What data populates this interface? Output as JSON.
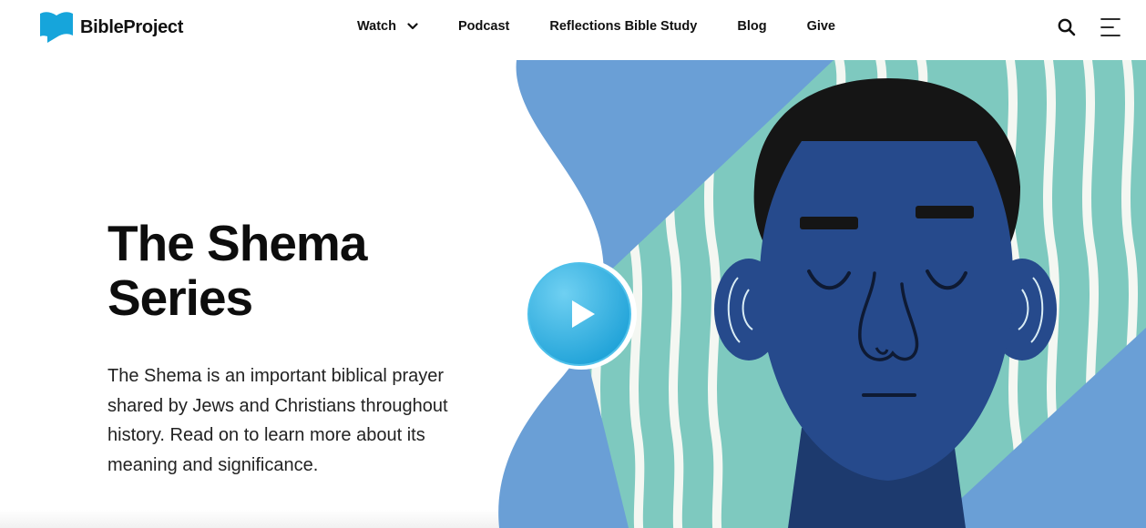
{
  "header": {
    "logo_text": "BibleProject",
    "nav": [
      {
        "label": "Watch",
        "has_dropdown": true
      },
      {
        "label": "Podcast"
      },
      {
        "label": "Reflections Bible Study"
      },
      {
        "label": "Blog"
      },
      {
        "label": "Give"
      }
    ],
    "icons": {
      "search": "search-icon",
      "menu": "hamburger-menu-icon",
      "dropdown": "chevron-down-icon"
    }
  },
  "hero": {
    "title": "The Shema Series",
    "description": "The Shema is an important biblical prayer shared by Jews and Christians throughout history. Read on to learn more about its meaning and significance.",
    "play_icon": "play-icon"
  },
  "colors": {
    "brand_blue": "#16a5db",
    "art_light_blue": "#6a9fd6",
    "art_teal": "#7ec9bf",
    "face_navy": "#264a8c",
    "hair_black": "#151515",
    "play_button": "#33b3e4"
  }
}
